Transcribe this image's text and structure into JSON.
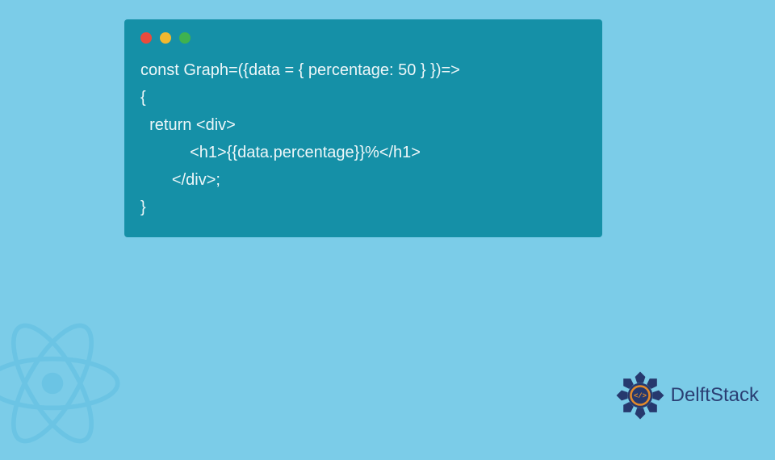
{
  "code": {
    "lines": [
      "const Graph=({data = { percentage: 50 } })=>",
      "{",
      "  return <div>",
      "           <h1>{{data.percentage}}%</h1>",
      "       </div>;",
      "}"
    ]
  },
  "branding": {
    "name": "DelftStack"
  },
  "colors": {
    "page_bg": "#7bcce8",
    "window_bg": "#1590a7",
    "code_text": "#eef7f9",
    "logo_text": "#2a3e73",
    "react_stroke": "#4fb6dd",
    "badge_dark": "#26396e",
    "badge_accent": "#e38a2b"
  }
}
